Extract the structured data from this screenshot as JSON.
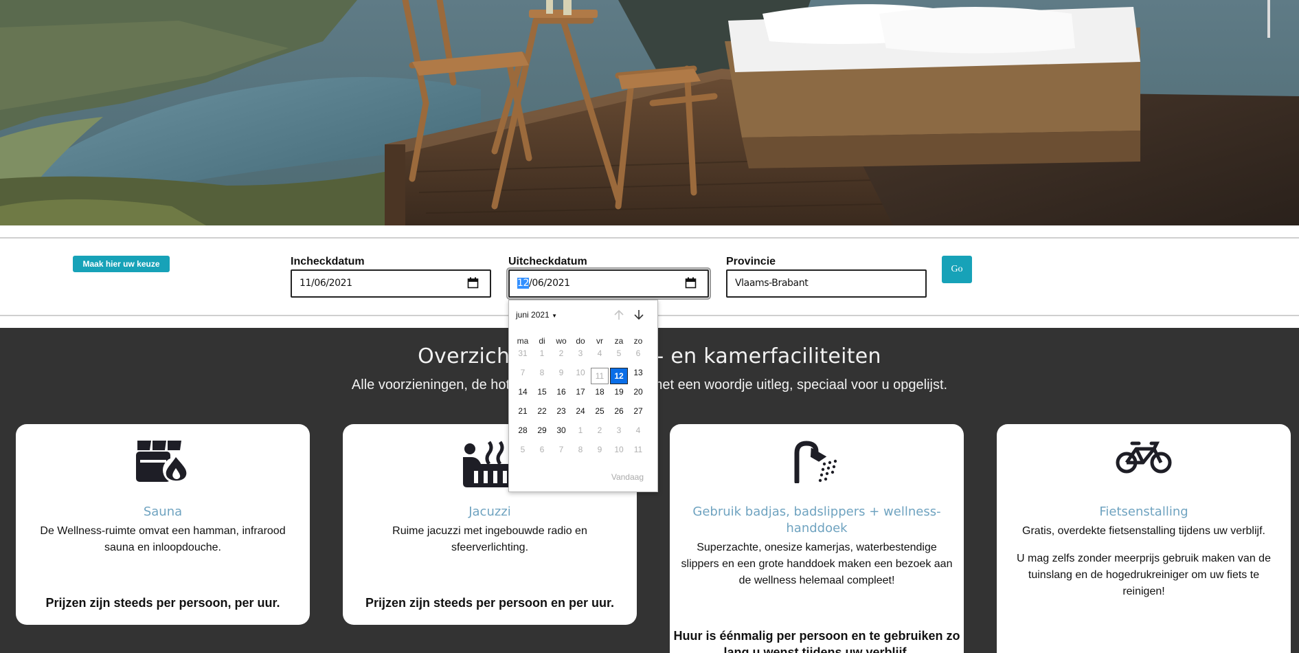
{
  "hero": {
    "alt": ""
  },
  "booking": {
    "choice_label": "Maak hier uw keuze",
    "checkin": {
      "label": "Incheckdatum",
      "value": "11/06/2021"
    },
    "checkout": {
      "label": "Uitcheckdatum",
      "value_selected": "12",
      "value_rest": "/06/2021"
    },
    "province": {
      "label": "Provincie",
      "value": "Vlaams-Brabant"
    },
    "go_label": "Go"
  },
  "datepicker": {
    "month_label": "juni 2021",
    "weekdays": [
      "ma",
      "di",
      "wo",
      "do",
      "vr",
      "za",
      "zo"
    ],
    "weeks": [
      [
        "31",
        "1",
        "2",
        "3",
        "4",
        "5",
        "6"
      ],
      [
        "7",
        "8",
        "9",
        "10",
        "11",
        "12",
        "13"
      ],
      [
        "14",
        "15",
        "16",
        "17",
        "18",
        "19",
        "20"
      ],
      [
        "21",
        "22",
        "23",
        "24",
        "25",
        "26",
        "27"
      ],
      [
        "28",
        "29",
        "30",
        "1",
        "2",
        "3",
        "4"
      ],
      [
        "5",
        "6",
        "7",
        "8",
        "9",
        "10",
        "11"
      ]
    ],
    "today_label": "Vandaag",
    "colors": {
      "selected": "#0a6ee8"
    }
  },
  "facilities": {
    "title": "Overzicht van de hotel- en kamerfaciliteiten",
    "subtitle": "Alle voorzieningen, de hotel- en kamerfaciliteiten met een woordje uitleg, speciaal voor u opgelijst.",
    "cards": [
      {
        "icon": "sauna-icon",
        "title": "Sauna",
        "text": "De Wellness-ruimte omvat een hamman, infrarood sauna en inloopdouche.",
        "price": "Prijzen zijn steeds per persoon, per uur."
      },
      {
        "icon": "hot-tub-icon",
        "title": "Jacuzzi",
        "text": "Ruime jacuzzi met ingebouwde radio en sfeerverlichting.",
        "price": "Prijzen zijn steeds per persoon en per uur."
      },
      {
        "icon": "shower-icon",
        "title": "Gebruik badjas, badslippers + wellness-handdoek",
        "text": "Superzachte, onesize kamerjas, waterbestendige slippers en een grote handdoek maken een bezoek aan de wellness helemaal compleet!",
        "price": "Huur is éénmalig per persoon en te gebruiken zo lang u wenst tijdens uw verblijf."
      },
      {
        "icon": "bicycle-icon",
        "title": "Fietsenstalling",
        "text": "Gratis, overdekte fietsenstalling tijdens uw verblijf.",
        "text2": "U mag zelfs zonder meerprijs gebruik maken van de tuinslang en de hogedrukreiniger om uw fiets te reinigen!"
      }
    ]
  }
}
